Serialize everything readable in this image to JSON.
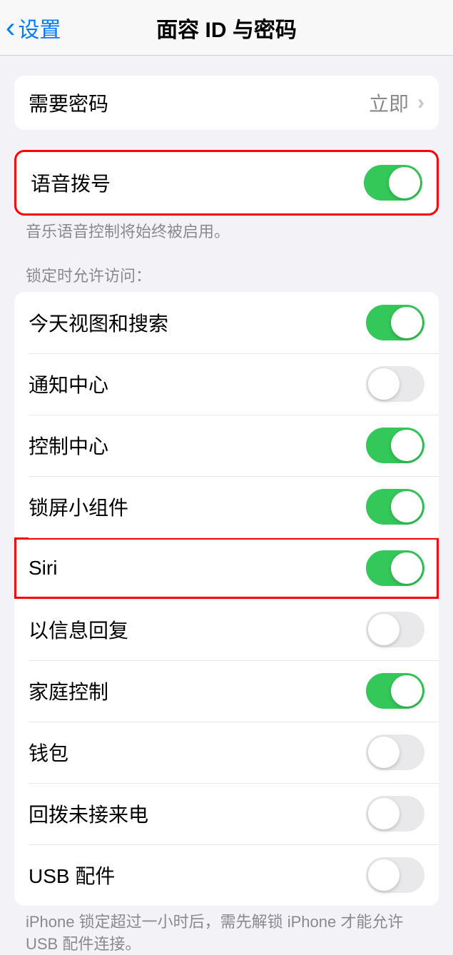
{
  "nav": {
    "back_label": "设置",
    "title": "面容 ID 与密码"
  },
  "require_passcode": {
    "label": "需要密码",
    "value": "立即"
  },
  "voice_dial": {
    "label": "语音拨号",
    "enabled": true,
    "footer": "音乐语音控制将始终被启用。"
  },
  "lock_access": {
    "header": "锁定时允许访问：",
    "items": [
      {
        "label": "今天视图和搜索",
        "enabled": true
      },
      {
        "label": "通知中心",
        "enabled": false
      },
      {
        "label": "控制中心",
        "enabled": true
      },
      {
        "label": "锁屏小组件",
        "enabled": true
      },
      {
        "label": "Siri",
        "enabled": true,
        "highlighted": true
      },
      {
        "label": "以信息回复",
        "enabled": false
      },
      {
        "label": "家庭控制",
        "enabled": true
      },
      {
        "label": "钱包",
        "enabled": false
      },
      {
        "label": "回拨未接来电",
        "enabled": false
      },
      {
        "label": "USB 配件",
        "enabled": false
      }
    ],
    "footer": "iPhone 锁定超过一小时后，需先解锁 iPhone 才能允许 USB 配件连接。"
  }
}
